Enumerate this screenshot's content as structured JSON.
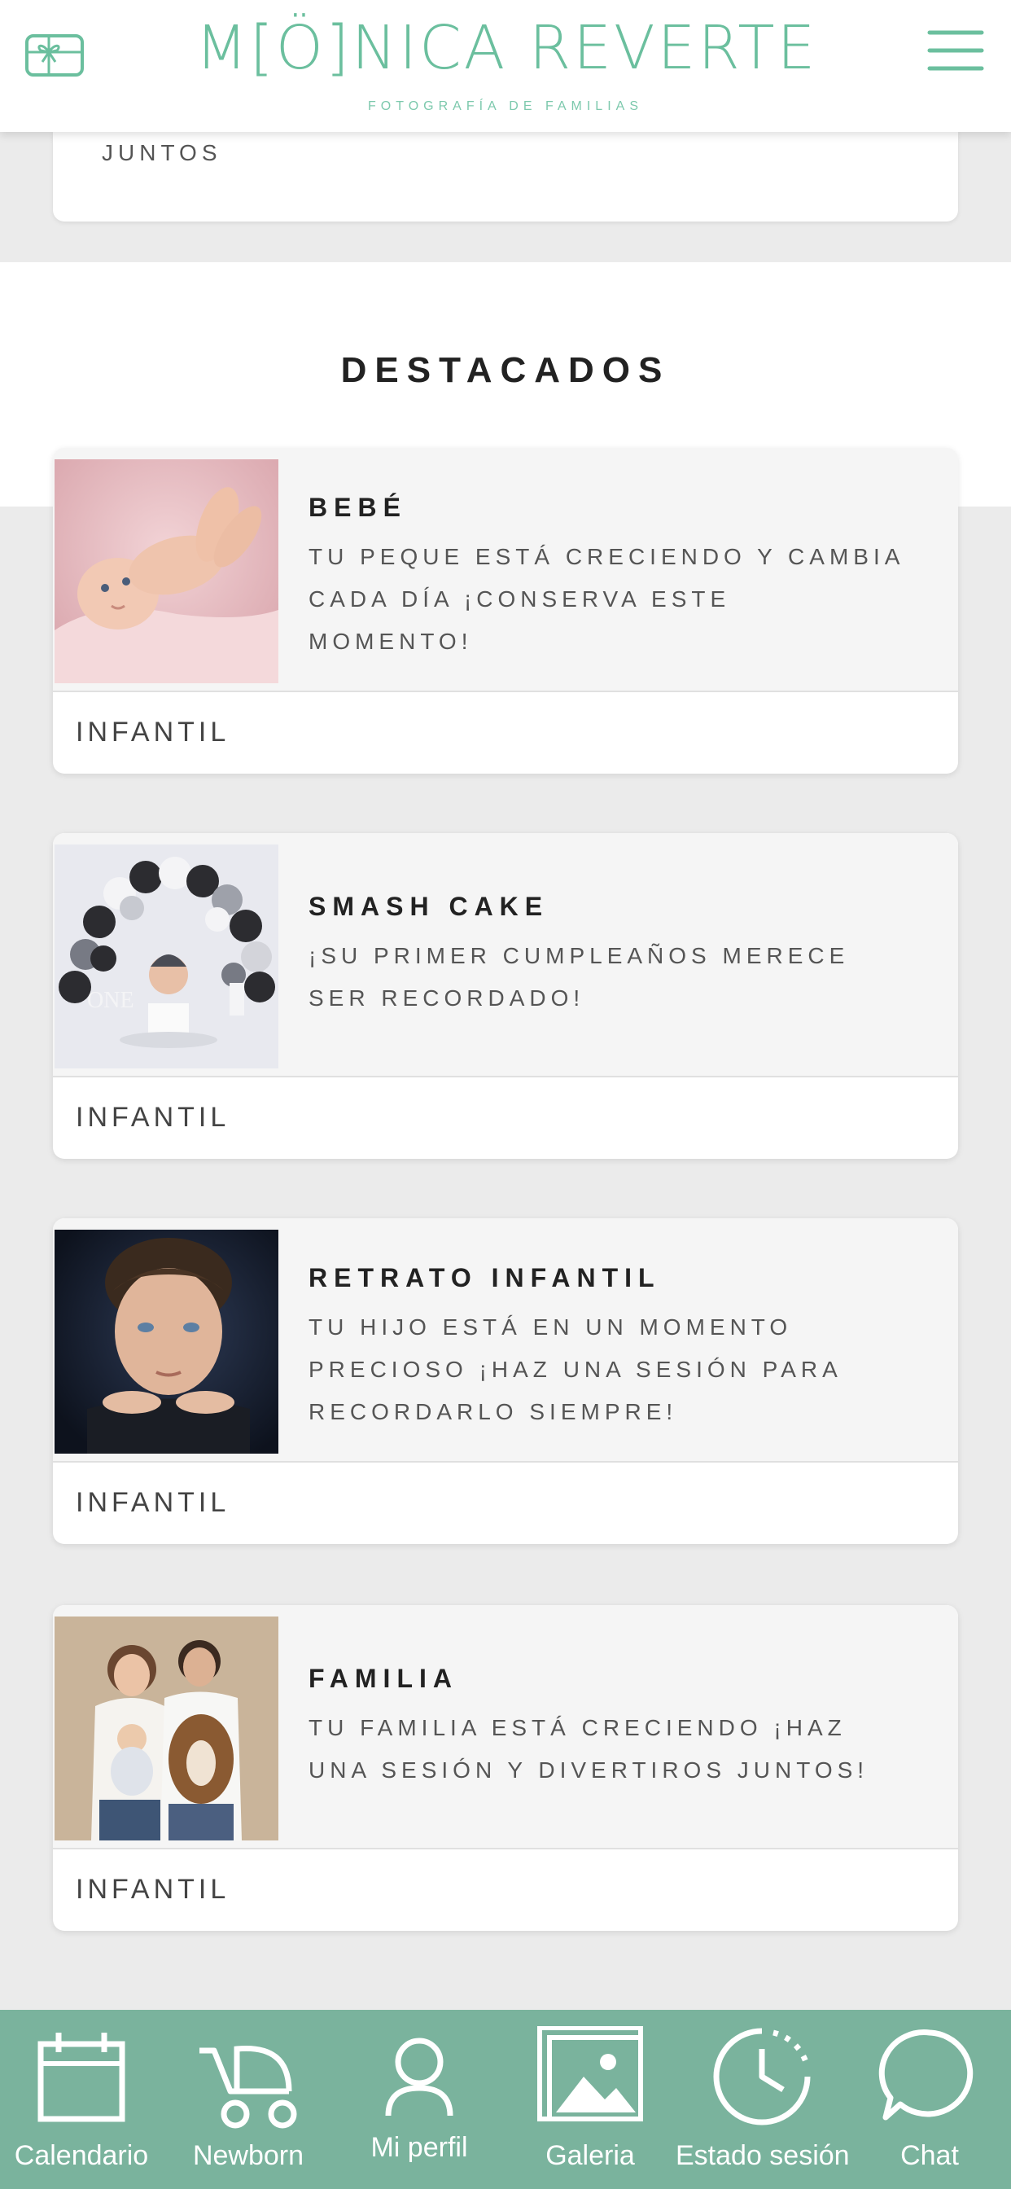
{
  "header": {
    "brand_name": "M[Ö]NICA REVERTE",
    "brand_subtitle": "FOTOGRAFÍA DE FAMILIAS",
    "gift_icon": "gift-card-icon",
    "menu_icon": "hamburger-menu-icon",
    "accent_color": "#6bbf9e"
  },
  "previous_card": {
    "text": "JUNTOS"
  },
  "featured": {
    "title": "DESTACADOS",
    "cards": [
      {
        "title": "BEBÉ",
        "desc_lines": [
          "TU PEQUE ESTÁ CRECIENDO Y CAMBIA",
          "CADA DÍA ¡CONSERVA ESTE",
          "MOMENTO!"
        ],
        "category": "INFANTIL"
      },
      {
        "title": "SMASH CAKE",
        "desc_lines": [
          "¡SU PRIMER CUMPLEAÑOS MERECE",
          "SER RECORDADO!"
        ],
        "category": "INFANTIL"
      },
      {
        "title": "RETRATO INFANTIL",
        "desc_lines": [
          "TU HIJO ESTÁ EN UN MOMENTO",
          "PRECIOSO ¡HAZ UNA SESIÓN PARA",
          "RECORDARLO SIEMPRE!"
        ],
        "category": "INFANTIL"
      },
      {
        "title": "FAMILIA",
        "desc_lines": [
          "TU FAMILIA ESTÁ CRECIENDO ¡HAZ",
          "UNA SESIÓN Y DIVERTIROS JUNTOS!"
        ],
        "category": "INFANTIL"
      }
    ]
  },
  "bottom_nav": {
    "background": "#7ab39d",
    "items": [
      {
        "label": "Calendario",
        "icon": "calendar-icon"
      },
      {
        "label": "Newborn",
        "icon": "baby-stroller-icon"
      },
      {
        "label": "Mi perfil",
        "icon": "user-icon"
      },
      {
        "label": "Galeria",
        "icon": "gallery-icon"
      },
      {
        "label": "Estado sesión",
        "icon": "clock-icon"
      },
      {
        "label": "Chat",
        "icon": "chat-bubble-icon"
      }
    ]
  }
}
